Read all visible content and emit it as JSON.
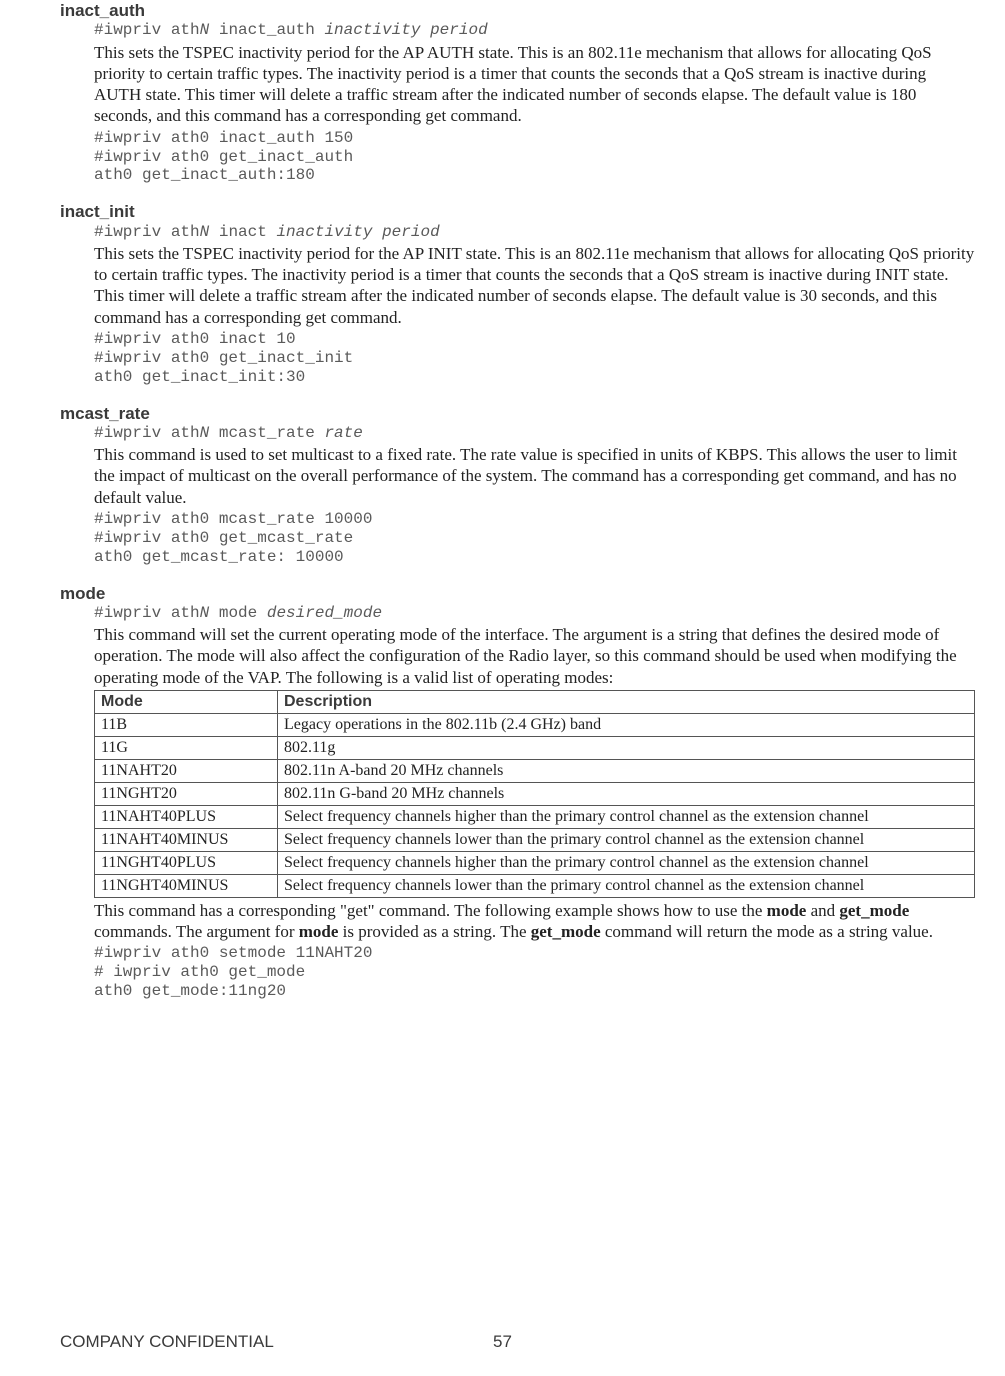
{
  "footer": {
    "confidential": "COMPANY CONFIDENTIAL",
    "page_number": "57"
  },
  "entries": {
    "inact_auth": {
      "title": "inact_auth",
      "syntax_lines": [
        {
          "prefix": "#iwpriv ath",
          "var1": "N",
          "mid": " inact_auth ",
          "var2": "inactivity period"
        }
      ],
      "desc": "This sets the TSPEC inactivity period for the AP AUTH state. This is an 802.11e mechanism that allows for allocating QoS priority to certain traffic types. The inactivity period is a timer that counts the seconds that a QoS stream is inactive during AUTH state. This timer will delete a traffic stream after the indicated number of seconds elapse. The default value is 180 seconds, and this command has a corresponding get command.",
      "example": "#iwpriv ath0 inact_auth 150\n#iwpriv ath0 get_inact_auth\nath0 get_inact_auth:180"
    },
    "inact_init": {
      "title": "inact_init",
      "syntax_lines": [
        {
          "prefix": "#iwpriv ath",
          "var1": "N",
          "mid": " inact ",
          "var2": "inactivity period"
        }
      ],
      "desc": "This sets the TSPEC inactivity period for the AP INIT state. This is an 802.11e mechanism that allows for allocating QoS priority to certain traffic types. The inactivity period is a timer that counts the seconds that a QoS stream is inactive during INIT state. This timer will delete a traffic stream after the indicated number of seconds elapse. The default value is 30 seconds, and this command has a corresponding get command.",
      "example": "#iwpriv ath0 inact 10\n#iwpriv ath0 get_inact_init\nath0 get_inact_init:30"
    },
    "mcast_rate": {
      "title": "mcast_rate",
      "syntax_lines": [
        {
          "prefix": "#iwpriv ath",
          "var1": "N",
          "mid": " mcast_rate ",
          "var2": "rate"
        }
      ],
      "desc": "This command is used to set multicast to a fixed rate. The rate value is specified in units of KBPS. This allows the user to limit the impact of multicast on the overall performance of the system. The command has a corresponding get command, and has no default value.",
      "example": "#iwpriv ath0 mcast_rate 10000\n#iwpriv ath0 get_mcast_rate\nath0 get_mcast_rate: 10000"
    },
    "mode": {
      "title": "mode",
      "syntax_lines": [
        {
          "prefix": "#iwpriv ath",
          "var1": "N",
          "mid": " mode ",
          "var2": "desired_mode"
        }
      ],
      "desc": "This command will set the current operating mode of the interface. The argument is a string that defines the desired mode of operation. The mode will also affect the configuration of the Radio layer, so this command should be used when modifying the operating mode of the VAP. The following is a valid list of operating modes:",
      "table": {
        "headers": [
          "Mode",
          "Description"
        ],
        "rows": [
          [
            "11B",
            "Legacy operations in the 802.11b (2.4 GHz) band"
          ],
          [
            "11G",
            "802.11g"
          ],
          [
            "11NAHT20",
            "802.11n A-band 20 MHz channels"
          ],
          [
            "11NGHT20",
            "802.11n G-band 20 MHz channels"
          ],
          [
            "11NAHT40PLUS",
            "Select frequency channels higher than the primary control channel as the extension channel"
          ],
          [
            "11NAHT40MINUS",
            "Select frequency channels lower than the primary control channel as the extension channel"
          ],
          [
            "11NGHT40PLUS",
            "Select frequency channels higher than the primary control channel as the extension channel"
          ],
          [
            "11NGHT40MINUS",
            "Select frequency channels lower than the primary control channel as the extension channel"
          ]
        ]
      },
      "post_table": {
        "prefix": "This command has a corresponding \"get\" command. The following example shows how to use the ",
        "b1": "mode",
        "mid1": " and ",
        "b2": "get_mode",
        "mid2": " commands. The argument for ",
        "b3": "mode",
        "mid3": " is provided as a string. The ",
        "b4": "get_mode",
        "suffix": " command will return the mode as a string value."
      },
      "example": "#iwpriv ath0 setmode 11NAHT20\n# iwpriv ath0 get_mode\nath0 get_mode:11ng20"
    }
  }
}
